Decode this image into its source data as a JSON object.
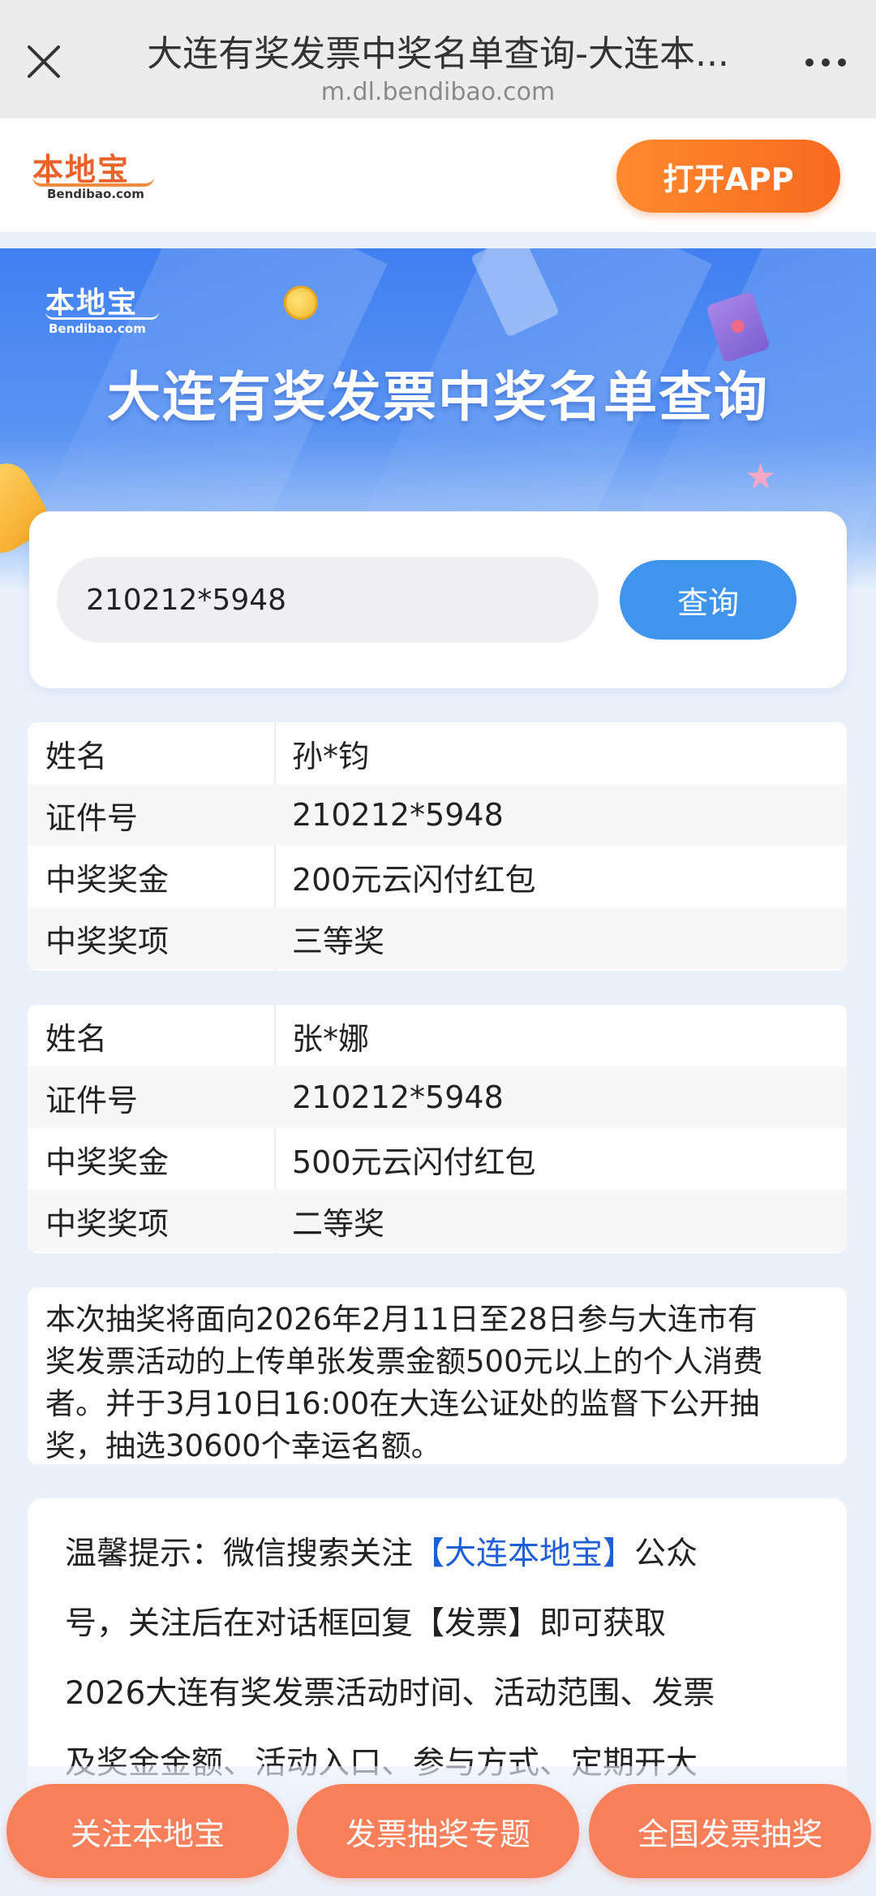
{
  "browser": {
    "title": "大连有奖发票中奖名单查询-大连本...",
    "url": "m.dl.bendibao.com"
  },
  "header": {
    "logo_text": "本地宝",
    "logo_sub": "Bendibao.com",
    "open_app": "打开APP"
  },
  "banner": {
    "logo_text": "本地宝",
    "logo_sub": "Bendibao.com",
    "title": "大连有奖发票中奖名单查询"
  },
  "search": {
    "value": "210212*5948",
    "button": "查询"
  },
  "results": [
    {
      "rows": [
        {
          "label": "姓名",
          "value": "孙*钧"
        },
        {
          "label": "证件号",
          "value": "210212*5948"
        },
        {
          "label": "中奖奖金",
          "value": "200元云闪付红包"
        },
        {
          "label": "中奖奖项",
          "value": "三等奖"
        }
      ]
    },
    {
      "rows": [
        {
          "label": "姓名",
          "value": "张*娜"
        },
        {
          "label": "证件号",
          "value": "210212*5948"
        },
        {
          "label": "中奖奖金",
          "value": "500元云闪付红包"
        },
        {
          "label": "中奖奖项",
          "value": "二等奖"
        }
      ]
    }
  ],
  "notice": {
    "lines": [
      "本次抽奖将面向2026年2月11日至28日参与大连市有",
      "奖发票活动的上传单张发票金额500元以上的个人消费",
      "者。并于3月10日16:00在大连公证处的监督下公开抽",
      "奖，抽选30600个幸运名额。"
    ]
  },
  "tip": {
    "prefix": "温馨提示：微信搜索关注",
    "highlight": "【大连本地宝】",
    "line1_suffix": "公众",
    "line2": "号，关注后在对话框回复【发票】即可获取",
    "line3": "2026大连有奖发票活动时间、活动范围、发票",
    "line4": "及奖金金额、活动入口、参与方式、定期开大"
  },
  "bottom": {
    "btn1": "关注本地宝",
    "btn2": "发票抽奖专题",
    "btn3": "全国发票抽奖"
  },
  "colors": {
    "accent_orange": "#f76a1e",
    "search_blue": "#3f95ec",
    "pill_coral": "#f7805b",
    "link_blue": "#1f5fd6"
  }
}
